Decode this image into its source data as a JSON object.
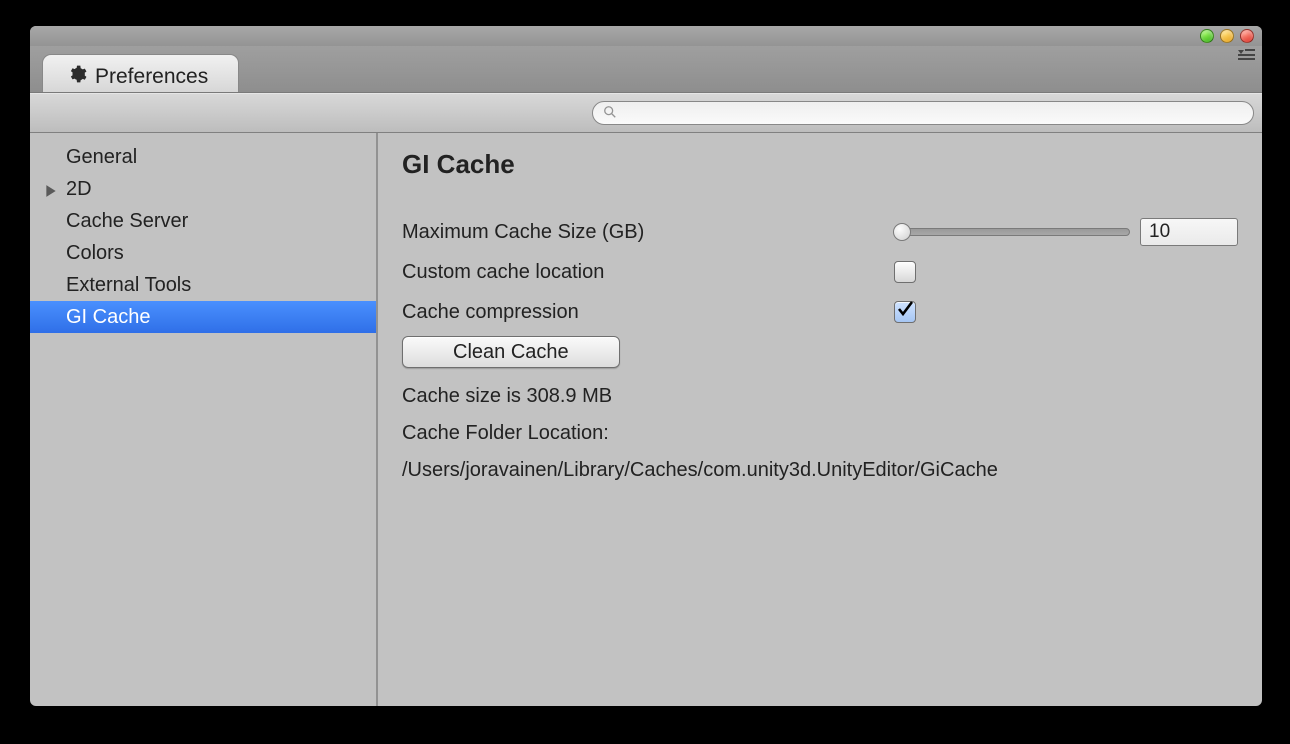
{
  "tab": {
    "title": "Preferences"
  },
  "search": {
    "placeholder": ""
  },
  "sidebar": {
    "items": [
      {
        "label": "General",
        "selected": false,
        "expandable": false
      },
      {
        "label": "2D",
        "selected": false,
        "expandable": true
      },
      {
        "label": "Cache Server",
        "selected": false,
        "expandable": false
      },
      {
        "label": "Colors",
        "selected": false,
        "expandable": false
      },
      {
        "label": "External Tools",
        "selected": false,
        "expandable": false
      },
      {
        "label": "GI Cache",
        "selected": true,
        "expandable": false
      }
    ]
  },
  "content": {
    "title": "GI Cache",
    "max_cache_label": "Maximum Cache Size (GB)",
    "max_cache_value": "10",
    "custom_location_label": "Custom cache location",
    "custom_location_checked": false,
    "compression_label": "Cache compression",
    "compression_checked": true,
    "clean_button": "Clean Cache",
    "cache_size_text": "Cache size is 308.9 MB",
    "folder_label": "Cache Folder Location:",
    "folder_path": "/Users/joravainen/Library/Caches/com.unity3d.UnityEditor/GiCache"
  }
}
